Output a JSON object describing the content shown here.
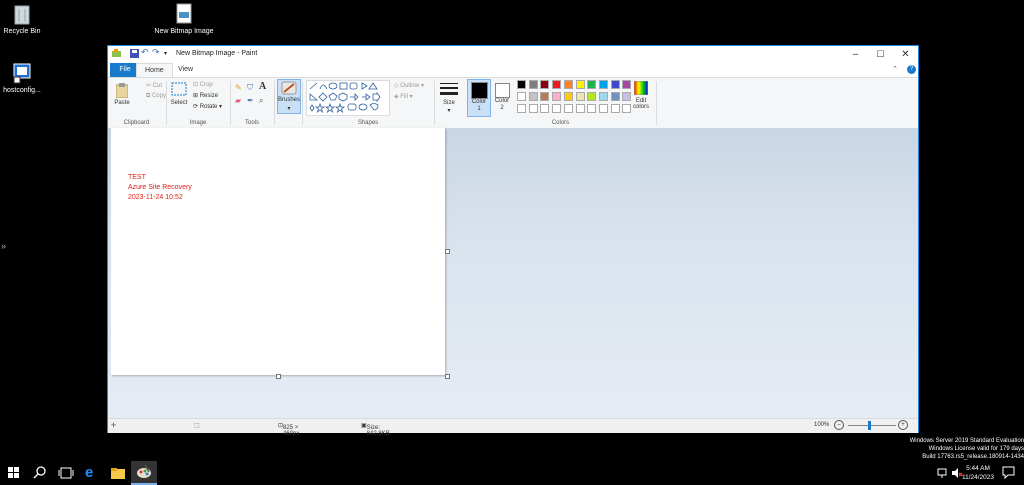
{
  "desktop": {
    "icons": [
      {
        "label": "Recycle Bin"
      },
      {
        "label": "New Bitmap Image"
      },
      {
        "label": "hostconfig..."
      }
    ]
  },
  "window": {
    "title": "New Bitmap Image - Paint",
    "tabs": [
      "File",
      "Home",
      "View"
    ],
    "ribbon": {
      "clipboard": {
        "paste": "Paste",
        "cut": "Cut",
        "copy": "Copy",
        "group": "Clipboard"
      },
      "image": {
        "select": "Select",
        "crop": "Crop",
        "resize": "Resize",
        "rotate": "Rotate",
        "group": "Image"
      },
      "tools": {
        "group": "Tools"
      },
      "brushes": {
        "label": "Brushes"
      },
      "shapes": {
        "outline": "Outline",
        "fill": "Fill",
        "group": "Shapes"
      },
      "size": {
        "label": "Size"
      },
      "colors": {
        "color1": "Color",
        "color1_num": "1",
        "color2": "Color",
        "color2_num": "2",
        "edit": "Edit",
        "edit2": "colors",
        "group": "Colors"
      }
    },
    "palette_row1": [
      "#000000",
      "#7f7f7f",
      "#880015",
      "#ed1c24",
      "#ff7f27",
      "#fff200",
      "#22b14c",
      "#00a2e8",
      "#3f48cc",
      "#a349a4"
    ],
    "palette_row2": [
      "#ffffff",
      "#c3c3c3",
      "#b97a57",
      "#ffaec9",
      "#ffc90e",
      "#efe4b0",
      "#b5e61d",
      "#99d9ea",
      "#7092be",
      "#c8bfe7"
    ],
    "canvas_text": {
      "line1": "TEST",
      "line2": "Azure Site Recovery",
      "line3": "2023-11-24 10:52"
    },
    "status": {
      "dimensions": "825 × 460px",
      "size": "Size: 842.8KB",
      "zoom": "100%"
    }
  },
  "watermark": {
    "line1": "Windows Server 2019 Standard Evaluation",
    "line2": "Windows License valid for 179 days",
    "line3": "Build 17763.rs5_release.180914-1434"
  },
  "clock": {
    "time": "5:44 AM",
    "date": "11/24/2023"
  }
}
